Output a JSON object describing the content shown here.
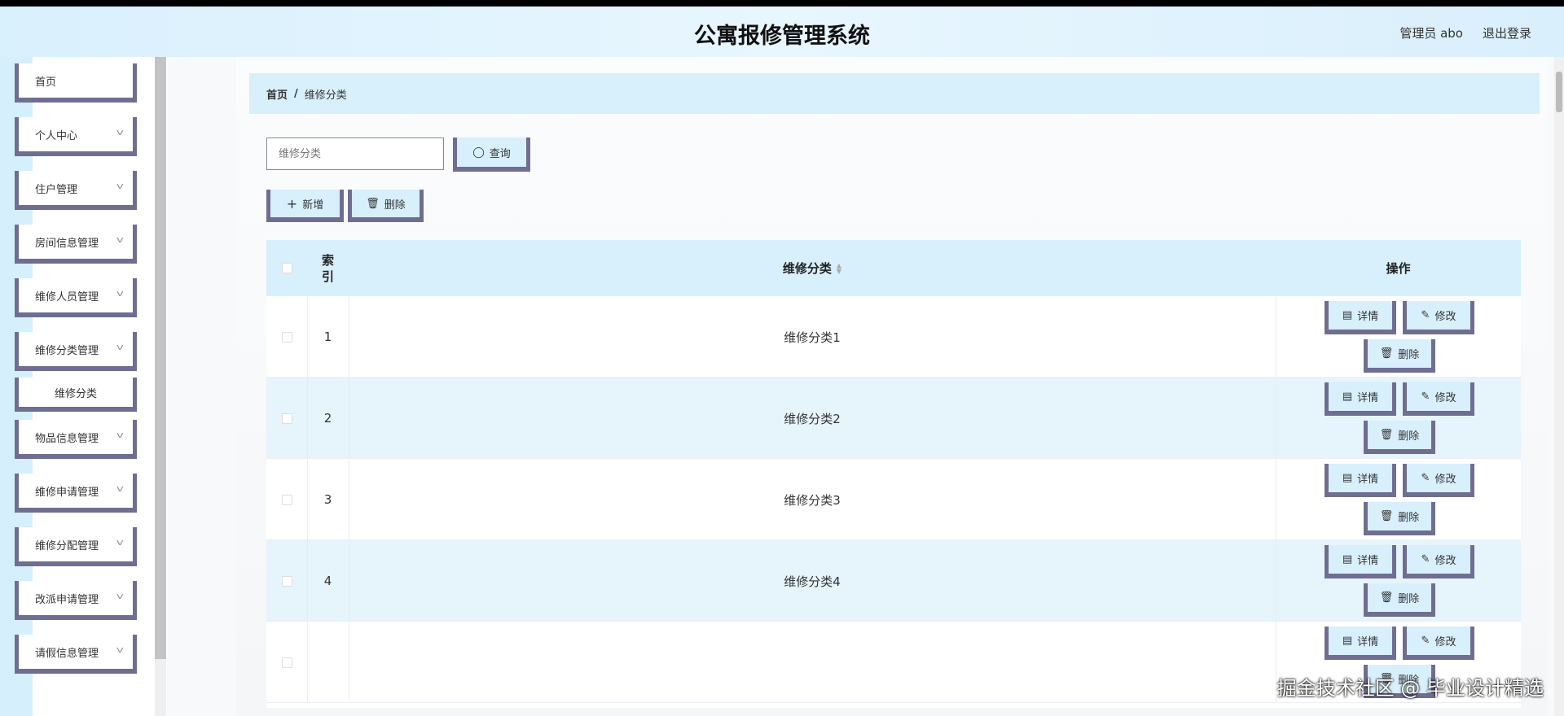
{
  "header": {
    "title": "公寓报修管理系统",
    "user": "管理员 abo",
    "logout": "退出登录"
  },
  "sidebar": {
    "items": [
      {
        "label": "首页",
        "expandable": false
      },
      {
        "label": "个人中心",
        "expandable": true
      },
      {
        "label": "住户管理",
        "expandable": true
      },
      {
        "label": "房间信息管理",
        "expandable": true
      },
      {
        "label": "维修人员管理",
        "expandable": true
      },
      {
        "label": "维修分类管理",
        "expandable": true
      },
      {
        "label": "维修分类",
        "expandable": false,
        "sub": true
      },
      {
        "label": "物品信息管理",
        "expandable": true
      },
      {
        "label": "维修申请管理",
        "expandable": true
      },
      {
        "label": "维修分配管理",
        "expandable": true
      },
      {
        "label": "改派申请管理",
        "expandable": true
      },
      {
        "label": "请假信息管理",
        "expandable": true
      }
    ]
  },
  "breadcrumb": {
    "home": "首页",
    "sep": "/",
    "current": "维修分类"
  },
  "search": {
    "placeholder": "维修分类",
    "value": "",
    "button": "查询"
  },
  "toolbar": {
    "add": "新增",
    "delete": "删除"
  },
  "table": {
    "headers": {
      "index": "索\n引",
      "name": "维修分类",
      "actions": "操作"
    },
    "rows": [
      {
        "index": "1",
        "name": "维修分类1"
      },
      {
        "index": "2",
        "name": "维修分类2"
      },
      {
        "index": "3",
        "name": "维修分类3"
      },
      {
        "index": "4",
        "name": "维修分类4"
      },
      {
        "index": "",
        "name": ""
      }
    ],
    "actions": {
      "detail": "详情",
      "edit": "修改",
      "delete": "删除"
    }
  },
  "watermark": "掘金技术社区 @ 毕业设计精选"
}
